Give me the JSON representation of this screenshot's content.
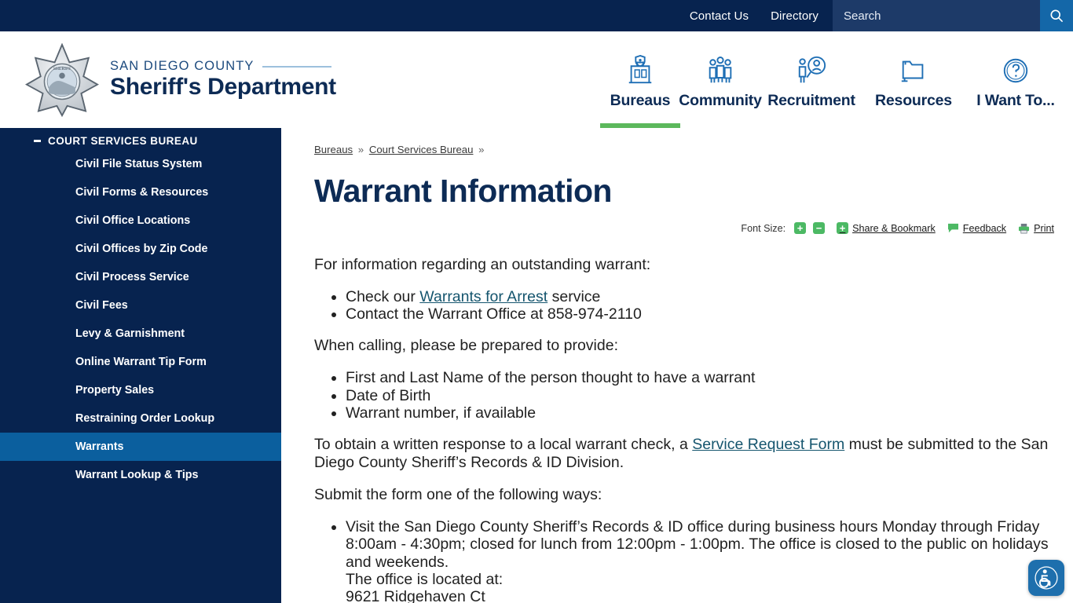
{
  "topbar": {
    "links": [
      {
        "label": "Contact Us",
        "name": "contact-us-link"
      },
      {
        "label": "Directory",
        "name": "directory-link"
      }
    ],
    "search": {
      "placeholder": "Search",
      "value": "",
      "button_icon": "search-icon"
    }
  },
  "header": {
    "logo_icon": "sheriff-badge-logo",
    "county": "SAN DIEGO COUNTY",
    "department": "Sheriff's Department",
    "nav": [
      {
        "label": "Bureaus",
        "icon": "building-icon",
        "active": true
      },
      {
        "label": "Community",
        "icon": "people-group-icon",
        "active": false
      },
      {
        "label": "Recruitment",
        "icon": "person-magnifier-icon",
        "active": false
      },
      {
        "label": "Resources",
        "icon": "folder-icon",
        "active": false
      },
      {
        "label": "I Want To...",
        "icon": "question-circle-icon",
        "active": false
      }
    ]
  },
  "sidebar": {
    "section_title": "COURT SERVICES BUREAU",
    "toggle_icon": "minus-icon",
    "items": [
      {
        "label": "Civil File Status System",
        "active": false
      },
      {
        "label": "Civil Forms & Resources",
        "active": false
      },
      {
        "label": "Civil Office Locations",
        "active": false
      },
      {
        "label": "Civil Offices by Zip Code",
        "active": false
      },
      {
        "label": "Civil Process Service",
        "active": false
      },
      {
        "label": "Civil Fees",
        "active": false
      },
      {
        "label": "Levy & Garnishment",
        "active": false
      },
      {
        "label": "Online Warrant Tip Form",
        "active": false
      },
      {
        "label": "Property Sales",
        "active": false
      },
      {
        "label": "Restraining Order Lookup",
        "active": false
      },
      {
        "label": "Warrants",
        "active": true
      },
      {
        "label": "Warrant Lookup & Tips",
        "active": false
      }
    ]
  },
  "breadcrumb": {
    "items": [
      {
        "label": "Bureaus"
      },
      {
        "label": "Court Services Bureau"
      }
    ],
    "separator": "»",
    "trailing_separator": "»"
  },
  "page": {
    "title": "Warrant Information"
  },
  "tools": {
    "font_size_label": "Font Size:",
    "increase_glyph": "+",
    "decrease_glyph": "−",
    "share_glyph": "+",
    "share_label": "Share & Bookmark",
    "feedback_label": "Feedback",
    "feedback_icon": "speech-bubble-icon",
    "print_label": "Print",
    "print_icon": "printer-icon"
  },
  "content": {
    "intro": "For information regarding an outstanding warrant:",
    "intro_list": [
      {
        "pre": "Check our ",
        "link": "Warrants for Arrest",
        "post": " service"
      },
      {
        "pre": "Contact the Warrant Office at 858-974-2110",
        "link": "",
        "post": ""
      }
    ],
    "calling_heading": "When calling, please be prepared to provide:",
    "calling_list": [
      "First and Last Name of the person thought to have a warrant",
      "Date of Birth",
      "Warrant number, if available"
    ],
    "written_response": {
      "pre": "To obtain a written response to a local warrant check, a ",
      "link": "Service Request Form",
      "post": " must be submitted to the San Diego County Sheriff’s Records & ID Division."
    },
    "submit_heading": "Submit the form one of the following ways:",
    "submit_list": [
      "Visit the San Diego County Sheriff’s Records & ID office during business hours Monday through Friday 8:00am - 4:30pm; closed for lunch from 12:00pm - 1:00pm. The office is closed to the public on holidays and weekends."
    ],
    "office_located_label": "The office is located at:",
    "office_address": "9621 Ridgehaven Ct"
  },
  "accessibility": {
    "icon": "accessibility-wheelchair-icon"
  },
  "colors": {
    "navy": "#07234f",
    "search_field": "#1d3a68",
    "search_button": "#1467a8",
    "active_sidebar": "#0b5f9e",
    "accent_green": "#5cb85c",
    "tool_green": "#4cb964",
    "link_teal": "#15556e",
    "icon_blue": "#1f6fb5"
  }
}
